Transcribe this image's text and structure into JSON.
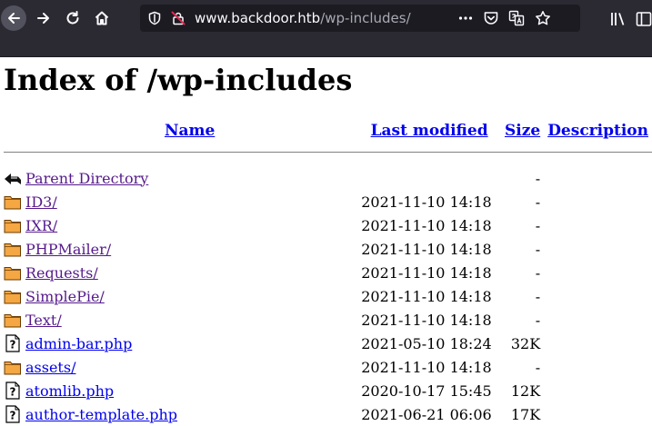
{
  "browser": {
    "url_host": "www.backdoor.htb",
    "url_path": "/wp-includes/"
  },
  "page": {
    "title": "Index of /wp-includes",
    "columns": {
      "name": "Name",
      "modified": "Last modified",
      "size": "Size",
      "description": "Description"
    },
    "rows": [
      {
        "icon": "back-icon",
        "name": "Parent Directory",
        "modified": "",
        "size": "-",
        "visited": true
      },
      {
        "icon": "folder-icon",
        "name": "ID3/",
        "modified": "2021-11-10 14:18",
        "size": "-",
        "visited": true
      },
      {
        "icon": "folder-icon",
        "name": "IXR/",
        "modified": "2021-11-10 14:18",
        "size": "-",
        "visited": true
      },
      {
        "icon": "folder-icon",
        "name": "PHPMailer/",
        "modified": "2021-11-10 14:18",
        "size": "-",
        "visited": true
      },
      {
        "icon": "folder-icon",
        "name": "Requests/",
        "modified": "2021-11-10 14:18",
        "size": "-",
        "visited": true
      },
      {
        "icon": "folder-icon",
        "name": "SimplePie/",
        "modified": "2021-11-10 14:18",
        "size": "-",
        "visited": true
      },
      {
        "icon": "folder-icon",
        "name": "Text/",
        "modified": "2021-11-10 14:18",
        "size": "-",
        "visited": true
      },
      {
        "icon": "unknown-file-icon",
        "name": "admin-bar.php",
        "modified": "2021-05-10 18:24",
        "size": "32K",
        "visited": false
      },
      {
        "icon": "folder-icon",
        "name": "assets/",
        "modified": "2021-11-10 14:18",
        "size": "-",
        "visited": false
      },
      {
        "icon": "unknown-file-icon",
        "name": "atomlib.php",
        "modified": "2020-10-17 15:45",
        "size": "12K",
        "visited": false
      },
      {
        "icon": "unknown-file-icon",
        "name": "author-template.php",
        "modified": "2021-06-21 06:06",
        "size": "17K",
        "visited": false
      }
    ]
  },
  "colors": {
    "link": "#0000ee",
    "visited_link": "#551a8b",
    "toolbar_bg": "#2b2a33",
    "urlbar_bg": "#1c1b22"
  }
}
